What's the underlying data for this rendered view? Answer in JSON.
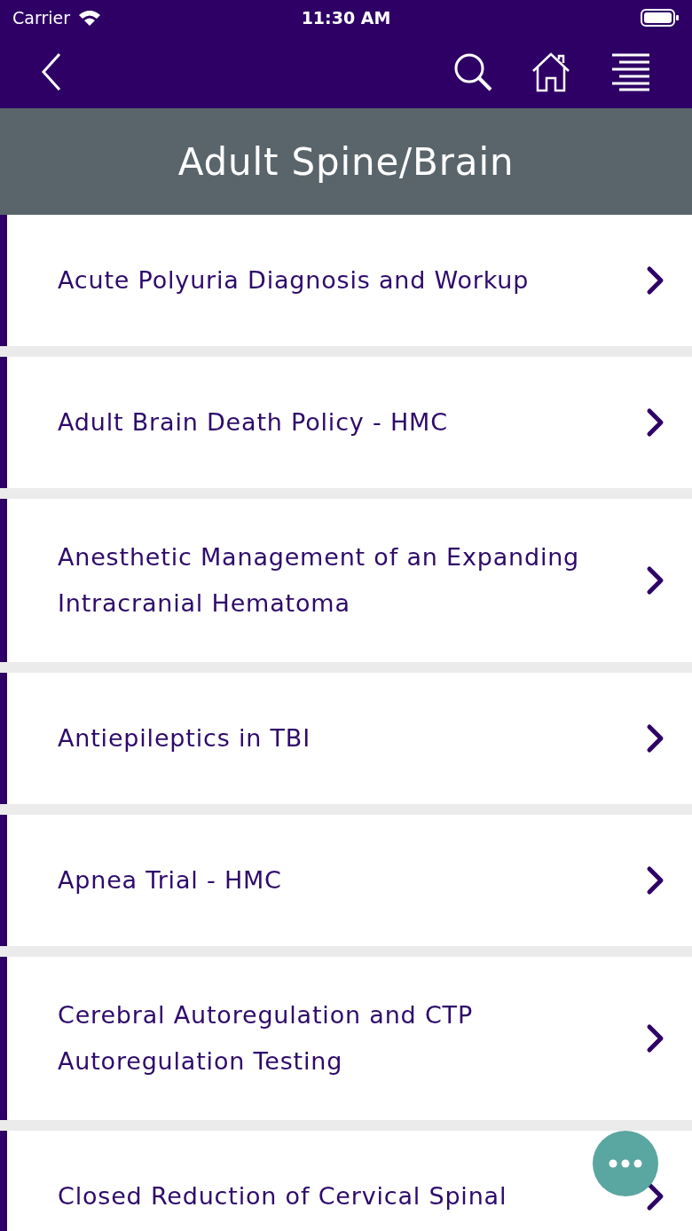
{
  "status_bar": {
    "carrier": "Carrier",
    "time": "11:30 AM"
  },
  "header": {
    "title": "Adult Spine/Brain"
  },
  "items": [
    {
      "label": "Acute Polyuria Diagnosis and Workup"
    },
    {
      "label": "Adult Brain Death Policy - HMC"
    },
    {
      "label": "Anesthetic Management of an Expanding Intracranial Hematoma"
    },
    {
      "label": "Antiepileptics in TBI"
    },
    {
      "label": "Apnea Trial - HMC"
    },
    {
      "label": "Cerebral Autoregulation and CTP Autoregulation Testing"
    },
    {
      "label": "Closed Reduction of Cervical Spinal"
    }
  ]
}
